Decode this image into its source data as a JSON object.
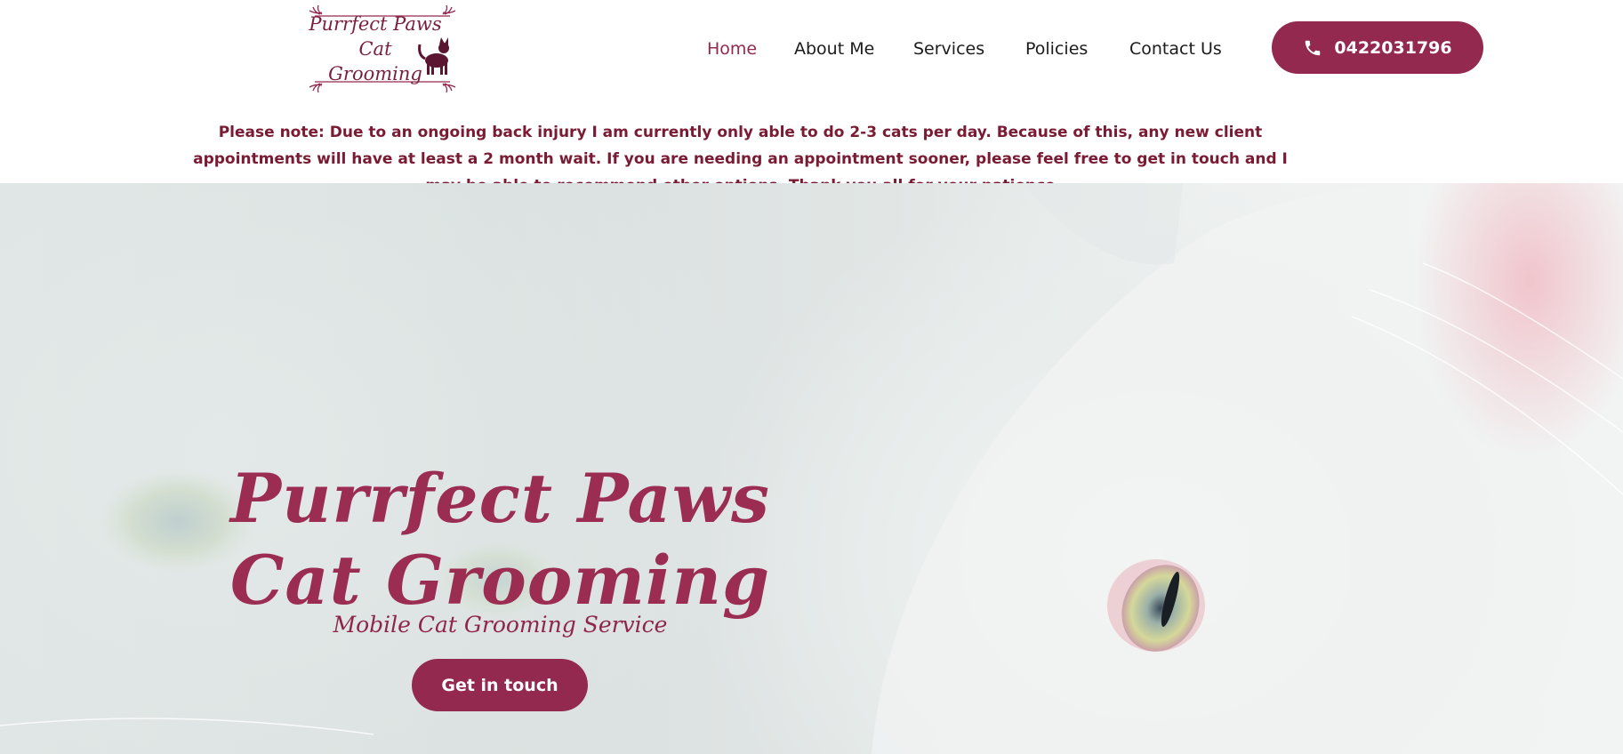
{
  "header": {
    "logo": {
      "text_line1": "Purrfect Paws Cat",
      "text_line2": "Grooming",
      "icon": "cat-silhouette-icon"
    },
    "nav": [
      {
        "label": "Home",
        "active": true
      },
      {
        "label": "About Me",
        "active": false
      },
      {
        "label": "Services",
        "active": false
      },
      {
        "label": "Policies",
        "active": false
      },
      {
        "label": "Contact Us",
        "active": false
      }
    ],
    "phone_button": {
      "label": "0422031796",
      "icon": "phone-icon"
    }
  },
  "notice": {
    "text": "Please note: Due to an ongoing back injury I am currently only able to do 2-3 cats per day. Because of this, any new client appointments will have at least a 2 month wait.  If you are needing an appointment sooner, please feel free to get in touch and I may be able to recommend other options. Thank you all for your patience"
  },
  "hero": {
    "title": "Purrfect Paws Cat Grooming",
    "subtitle": "Mobile Cat Grooming Service",
    "cta_label": "Get in touch",
    "background_image": "white-cat-closeup-photo"
  },
  "colors": {
    "brand": "#93294f",
    "notice_text": "#7a1a33",
    "nav_text": "#1b1b1b",
    "nav_active": "#93294f"
  }
}
